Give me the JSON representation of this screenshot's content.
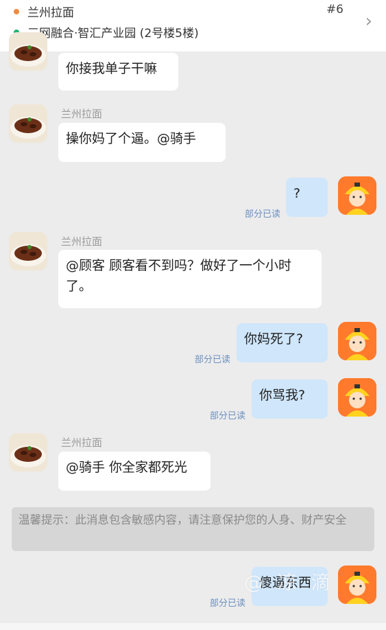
{
  "header": {
    "store_name": "兰州拉面",
    "address": "三网融合·智汇产业园 (2号楼5楼)",
    "order_number": "#6",
    "store_dot_color": "#f08a3c",
    "address_dot_color": "#22b573"
  },
  "messages": [
    {
      "text": "你接我单子干嘛"
    },
    {
      "sender": "兰州拉面",
      "text": "操你妈了个逼。@骑手"
    },
    {
      "text": "?",
      "read_status": "部分已读"
    },
    {
      "sender": "兰州拉面",
      "text": "@顾客 顾客看不到吗？做好了一个小时了。"
    },
    {
      "text": "你妈死了?",
      "read_status": "部分已读"
    },
    {
      "text": "你骂我?",
      "read_status": "部分已读"
    },
    {
      "sender": "兰州拉面",
      "text": "@骑手 你全家都死光"
    },
    {
      "text": "傻逼东西",
      "read_status": "部分已读"
    }
  ],
  "warning": "温馨提示：此消息包含敏感内容，请注意保护您的人身、财产安全",
  "watermark": "@ 凉 滴",
  "colors": {
    "outgoing_bubble": "#cfe6fb",
    "incoming_bubble": "#ffffff",
    "read_status": "#6b8fbf",
    "rider_avatar": "#ff7a2d"
  },
  "icons": {
    "chevron": "chevron-right-icon",
    "store_avatar": "noodle-bowl-avatar",
    "rider_avatar": "rider-avatar"
  }
}
